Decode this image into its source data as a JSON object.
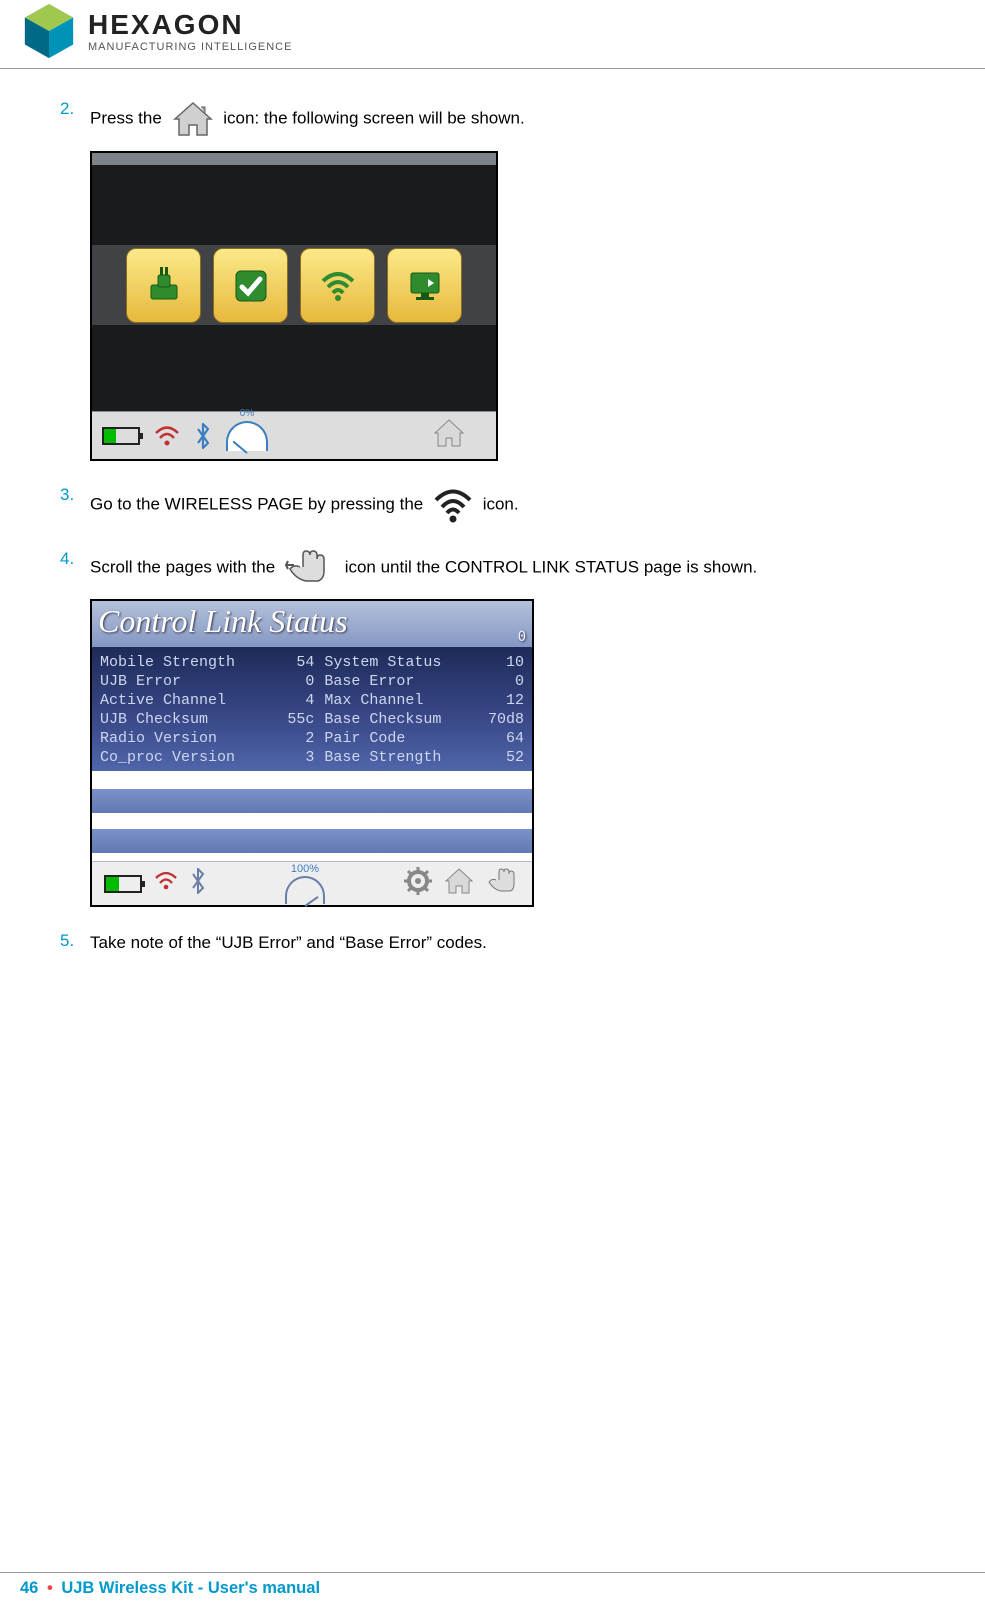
{
  "brand": {
    "name": "HEXAGON",
    "subtitle": "MANUFACTURING INTELLIGENCE"
  },
  "steps": {
    "s2": {
      "num": "2.",
      "t1": "Press the ",
      "t2": " icon: the following screen will be shown."
    },
    "s3": {
      "num": "3.",
      "t1": "Go to the WIRELESS PAGE by pressing the ",
      "t2": " icon."
    },
    "s4": {
      "num": "4.",
      "t1": "Scroll the pages with the ",
      "t2": " icon until the CONTROL LINK STATUS page is shown."
    },
    "s5": {
      "num": "5.",
      "t1": "Take note of the “UJB Error” and “Base Error” codes."
    }
  },
  "shot1": {
    "gauge_label": "0%"
  },
  "shot2": {
    "title": "Control Link Status",
    "corner": "0",
    "rows": [
      {
        "l": "Mobile Strength",
        "lv": "54",
        "r": "System Status",
        "rv": "10"
      },
      {
        "l": "UJB Error",
        "lv": "0",
        "r": "Base Error",
        "rv": "0"
      },
      {
        "l": "Active Channel",
        "lv": "4",
        "r": "Max Channel",
        "rv": "12"
      },
      {
        "l": "UJB Checksum",
        "lv": "55c",
        "r": "Base Checksum",
        "rv": "70d8"
      },
      {
        "l": "Radio Version",
        "lv": "2",
        "r": "Pair Code",
        "rv": "64"
      },
      {
        "l": "Co_proc Version",
        "lv": "3",
        "r": "Base Strength",
        "rv": "52"
      }
    ],
    "gauge_label": "100%"
  },
  "footer": {
    "page": "46",
    "sep": "•",
    "title": "UJB Wireless Kit - User's manual"
  }
}
